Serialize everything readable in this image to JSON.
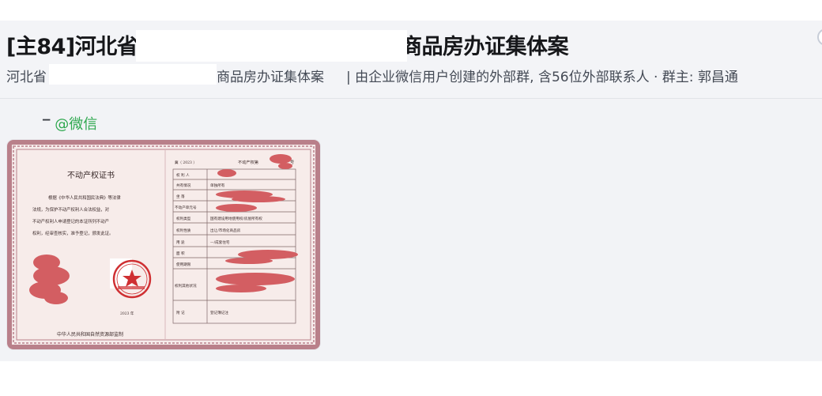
{
  "header": {
    "title_left": "[主84]河北省",
    "title_right": "商品房办证集体案",
    "subtitle_left": "河北省",
    "subtitle_mid": "商品房办证集体案",
    "subtitle_right": "| 由企业微信用户创建的外部群, 含56位外部联系人 · 群主: 郭昌通"
  },
  "message": {
    "sender_name": "@微信",
    "image": {
      "title": "不动产权证书",
      "body_lines": [
        "根据《中华人民共和国民法典》等法律",
        "法规，为保护不动产权利人合法权益，对",
        "不动产权利人申请登记的本证所列不动产",
        "权利，经审查核实，准予登记，颁发此证。"
      ],
      "issuer": "中华人民共和国自然资源部监制",
      "top_line_left": "冀（ 2023 ）",
      "top_line_right": "不动产权第",
      "top_line_end": "号",
      "table_rows": [
        {
          "label": "权 利 人",
          "value": ""
        },
        {
          "label": "共有情况",
          "value": "单独所有"
        },
        {
          "label": "坐 落",
          "value": ""
        },
        {
          "label": "不动产单元号",
          "value": ""
        },
        {
          "label": "权利类型",
          "value": "国有建设用地使用权/房屋所有权"
        },
        {
          "label": "权利性质",
          "value": "出让/市场化商品房"
        },
        {
          "label": "用 途",
          "value": "—/成套住宅"
        },
        {
          "label": "面 积",
          "value": ""
        },
        {
          "label": "使用期限",
          "value": ""
        },
        {
          "label": "权利其他状况",
          "value": ""
        },
        {
          "label": "附 记",
          "value": "登记簿记注"
        }
      ],
      "date_text": "2023 年",
      "colors": {
        "border": "#b9808a",
        "paper": "#f7ecea",
        "redaction": "#d35e62",
        "seal": "#cf2f32"
      }
    }
  }
}
